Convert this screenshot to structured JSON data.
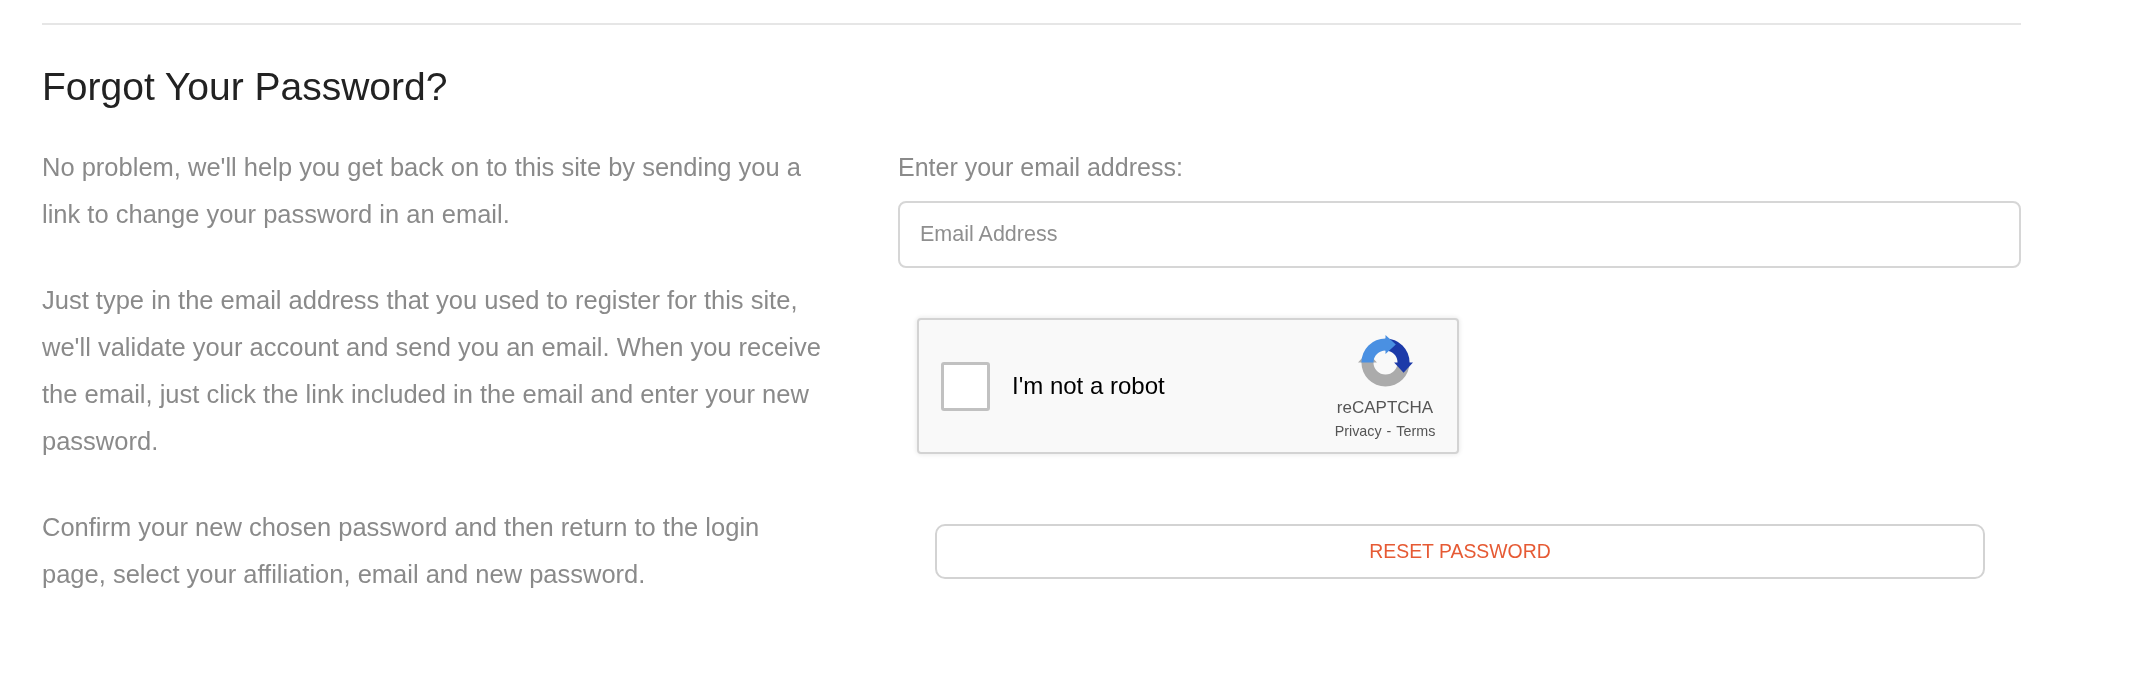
{
  "heading": "Forgot Your Password?",
  "intro": [
    "No problem, we'll help you get back on to this site by sending you a link to change your password in an email.",
    "Just type in the email address that you used to register for this site, we'll validate your account and send you an email. When you receive the email, just click the link included in the email and enter your new password.",
    "Confirm your new chosen password and then return to the login page, select your affiliation, email and new password."
  ],
  "email": {
    "label": "Enter your email address:",
    "placeholder": "Email Address"
  },
  "captcha": {
    "checked": false,
    "label": "I'm not a robot",
    "brand": "reCAPTCHA",
    "links": [
      "Privacy",
      "Terms"
    ],
    "separator": "-"
  },
  "reset_button": {
    "label": "RESET PASSWORD"
  }
}
